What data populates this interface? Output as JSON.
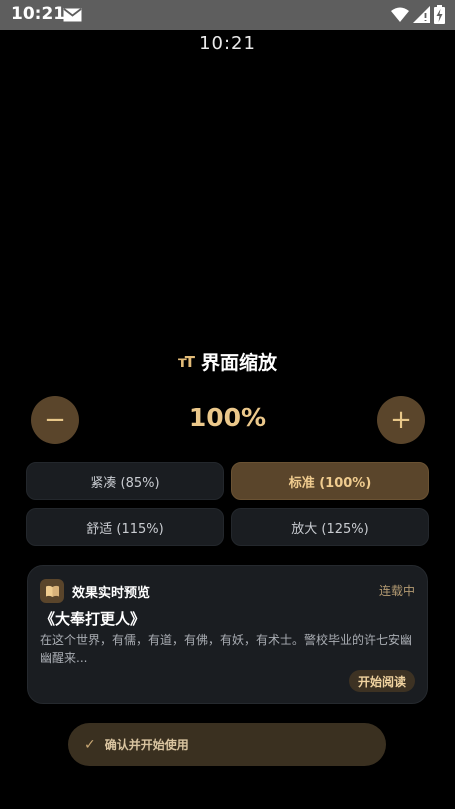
{
  "status_bar": {
    "time": "10:21"
  },
  "clock": "10:21",
  "header": {
    "icon": "ᴛT",
    "title": "界面缩放"
  },
  "scale": {
    "minus_symbol": "−",
    "plus_symbol": "+",
    "value": "100%"
  },
  "options": [
    {
      "label": "紧凑 (85%)",
      "selected": false
    },
    {
      "label": "标准 (100%)",
      "selected": true
    },
    {
      "label": "舒适 (115%)",
      "selected": false
    },
    {
      "label": "放大 (125%)",
      "selected": false
    }
  ],
  "preview": {
    "title": "效果实时预览",
    "status": "连载中",
    "book_title": "《大奉打更人》",
    "description": "在这个世界，有儒，有道，有佛，有妖，有术士。警校毕业的许七安幽幽醒来...",
    "read_label": "开始阅读"
  },
  "confirm": {
    "check": "✓",
    "label": "确认并开始使用"
  },
  "colors": {
    "accent": "#ebc88b",
    "button_bg": "#5a452b",
    "card_bg": "#1a1d21"
  }
}
